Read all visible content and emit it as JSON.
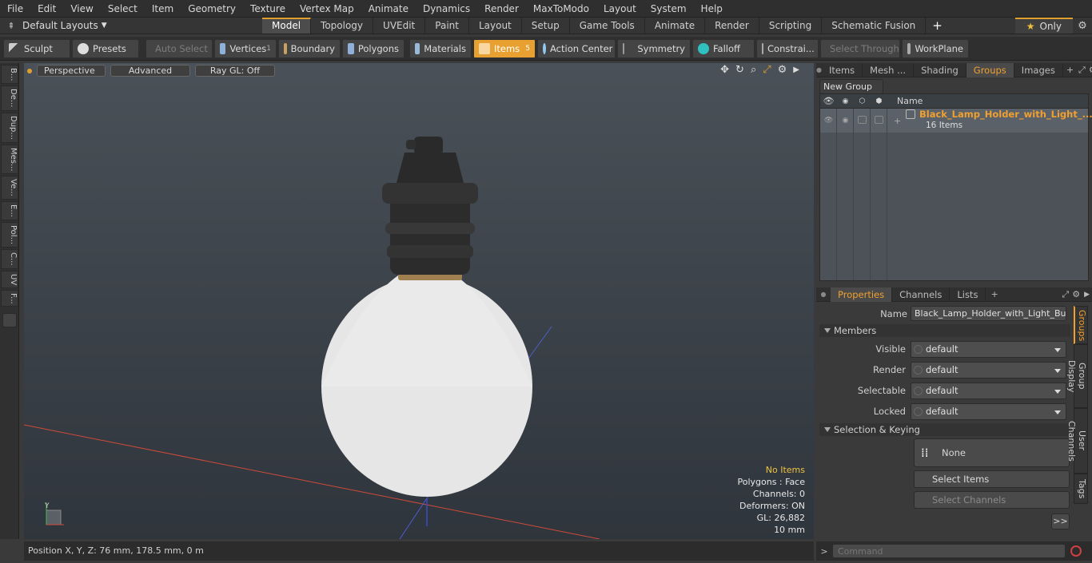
{
  "menu": [
    "File",
    "Edit",
    "View",
    "Select",
    "Item",
    "Geometry",
    "Texture",
    "Vertex Map",
    "Animate",
    "Dynamics",
    "Render",
    "MaxToModo",
    "Layout",
    "System",
    "Help"
  ],
  "layoutbar": {
    "layout_selector": "Default Layouts",
    "tabs": [
      "Model",
      "Topology",
      "UVEdit",
      "Paint",
      "Layout",
      "Setup",
      "Game Tools",
      "Animate",
      "Render",
      "Scripting",
      "Schematic Fusion"
    ],
    "active_tab": "Model",
    "add_label": "+",
    "only_label": "Only"
  },
  "toolbar": {
    "sculpt": "Sculpt",
    "presets": "Presets",
    "auto_select": "Auto Select",
    "vertices": "Vertices",
    "vertices_count": "1",
    "boundary": "Boundary",
    "polygons": "Polygons",
    "materials": "Materials",
    "items": "Items",
    "items_count": "5",
    "action_center": "Action Center",
    "symmetry": "Symmetry",
    "falloff": "Falloff",
    "constraints": "Constrai...",
    "select_through": "Select Through",
    "workplane": "WorkPlane"
  },
  "left_strip": [
    "B...",
    "De...",
    "Dup...",
    "Mes...",
    "Ve...",
    "E...",
    "Pol...",
    "C...",
    "UV",
    "F..."
  ],
  "viewport": {
    "view_mode": "Perspective",
    "shading": "Advanced",
    "raygl": "Ray GL: Off",
    "stats": {
      "selection": "No Items",
      "polygons": "Polygons : Face",
      "channels": "Channels: 0",
      "deformers": "Deformers: ON",
      "gl": "GL: 26,882",
      "scale": "10 mm"
    },
    "axis_y": "Y"
  },
  "statusbar": {
    "position": "Position X, Y, Z:   76 mm, 178.5 mm, 0 m"
  },
  "items_panel": {
    "tabs": [
      "Items",
      "Mesh ...",
      "Shading",
      "Groups",
      "Images"
    ],
    "active_tab": "Groups",
    "new_group": "New Group",
    "column_name": "Name",
    "group_name": "Black_Lamp_Holder_with_Light_...",
    "group_count": "16 Items"
  },
  "properties_panel": {
    "tabs": [
      "Properties",
      "Channels",
      "Lists"
    ],
    "active_tab": "Properties",
    "name_label": "Name",
    "name_value": "Black_Lamp_Holder_with_Light_Bulb (",
    "members_section": "Members",
    "fields": [
      {
        "label": "Visible",
        "value": "default"
      },
      {
        "label": "Render",
        "value": "default"
      },
      {
        "label": "Selectable",
        "value": "default"
      },
      {
        "label": "Locked",
        "value": "default"
      }
    ],
    "keying_section": "Selection & Keying",
    "none_label": "None",
    "select_items": "Select Items",
    "select_channels": "Select Channels",
    "more": ">>",
    "side_tabs": [
      "Groups",
      "Group Display",
      "User Channels",
      "Tags"
    ]
  },
  "command": {
    "prompt": ">",
    "placeholder": "Command"
  },
  "colors": {
    "accent": "#e8a030",
    "bg": "#3a3a3a"
  }
}
